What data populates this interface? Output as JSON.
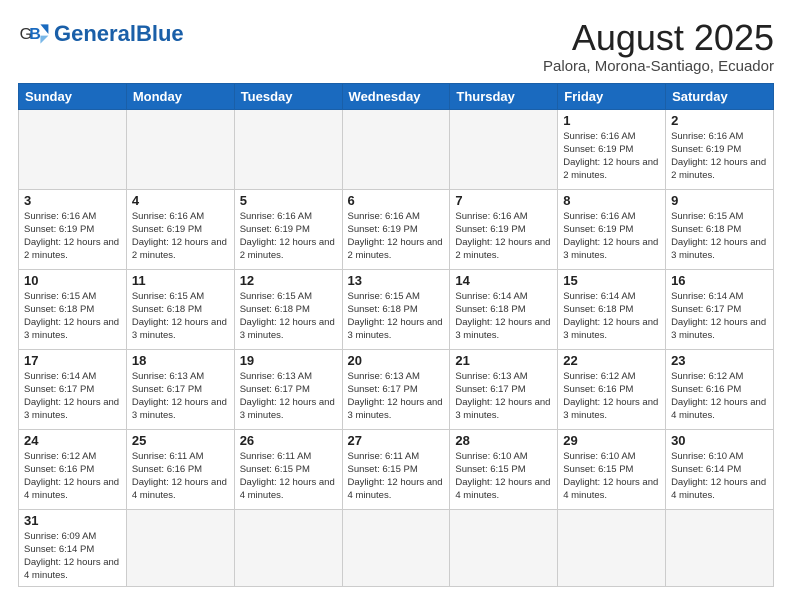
{
  "header": {
    "logo_text_normal": "General",
    "logo_text_bold": "Blue",
    "title": "August 2025",
    "subtitle": "Palora, Morona-Santiago, Ecuador"
  },
  "calendar": {
    "days_of_week": [
      "Sunday",
      "Monday",
      "Tuesday",
      "Wednesday",
      "Thursday",
      "Friday",
      "Saturday"
    ],
    "weeks": [
      [
        {
          "day": "",
          "info": ""
        },
        {
          "day": "",
          "info": ""
        },
        {
          "day": "",
          "info": ""
        },
        {
          "day": "",
          "info": ""
        },
        {
          "day": "",
          "info": ""
        },
        {
          "day": "1",
          "info": "Sunrise: 6:16 AM\nSunset: 6:19 PM\nDaylight: 12 hours and 2 minutes."
        },
        {
          "day": "2",
          "info": "Sunrise: 6:16 AM\nSunset: 6:19 PM\nDaylight: 12 hours and 2 minutes."
        }
      ],
      [
        {
          "day": "3",
          "info": "Sunrise: 6:16 AM\nSunset: 6:19 PM\nDaylight: 12 hours and 2 minutes."
        },
        {
          "day": "4",
          "info": "Sunrise: 6:16 AM\nSunset: 6:19 PM\nDaylight: 12 hours and 2 minutes."
        },
        {
          "day": "5",
          "info": "Sunrise: 6:16 AM\nSunset: 6:19 PM\nDaylight: 12 hours and 2 minutes."
        },
        {
          "day": "6",
          "info": "Sunrise: 6:16 AM\nSunset: 6:19 PM\nDaylight: 12 hours and 2 minutes."
        },
        {
          "day": "7",
          "info": "Sunrise: 6:16 AM\nSunset: 6:19 PM\nDaylight: 12 hours and 2 minutes."
        },
        {
          "day": "8",
          "info": "Sunrise: 6:16 AM\nSunset: 6:19 PM\nDaylight: 12 hours and 3 minutes."
        },
        {
          "day": "9",
          "info": "Sunrise: 6:15 AM\nSunset: 6:18 PM\nDaylight: 12 hours and 3 minutes."
        }
      ],
      [
        {
          "day": "10",
          "info": "Sunrise: 6:15 AM\nSunset: 6:18 PM\nDaylight: 12 hours and 3 minutes."
        },
        {
          "day": "11",
          "info": "Sunrise: 6:15 AM\nSunset: 6:18 PM\nDaylight: 12 hours and 3 minutes."
        },
        {
          "day": "12",
          "info": "Sunrise: 6:15 AM\nSunset: 6:18 PM\nDaylight: 12 hours and 3 minutes."
        },
        {
          "day": "13",
          "info": "Sunrise: 6:15 AM\nSunset: 6:18 PM\nDaylight: 12 hours and 3 minutes."
        },
        {
          "day": "14",
          "info": "Sunrise: 6:14 AM\nSunset: 6:18 PM\nDaylight: 12 hours and 3 minutes."
        },
        {
          "day": "15",
          "info": "Sunrise: 6:14 AM\nSunset: 6:18 PM\nDaylight: 12 hours and 3 minutes."
        },
        {
          "day": "16",
          "info": "Sunrise: 6:14 AM\nSunset: 6:17 PM\nDaylight: 12 hours and 3 minutes."
        }
      ],
      [
        {
          "day": "17",
          "info": "Sunrise: 6:14 AM\nSunset: 6:17 PM\nDaylight: 12 hours and 3 minutes."
        },
        {
          "day": "18",
          "info": "Sunrise: 6:13 AM\nSunset: 6:17 PM\nDaylight: 12 hours and 3 minutes."
        },
        {
          "day": "19",
          "info": "Sunrise: 6:13 AM\nSunset: 6:17 PM\nDaylight: 12 hours and 3 minutes."
        },
        {
          "day": "20",
          "info": "Sunrise: 6:13 AM\nSunset: 6:17 PM\nDaylight: 12 hours and 3 minutes."
        },
        {
          "day": "21",
          "info": "Sunrise: 6:13 AM\nSunset: 6:17 PM\nDaylight: 12 hours and 3 minutes."
        },
        {
          "day": "22",
          "info": "Sunrise: 6:12 AM\nSunset: 6:16 PM\nDaylight: 12 hours and 3 minutes."
        },
        {
          "day": "23",
          "info": "Sunrise: 6:12 AM\nSunset: 6:16 PM\nDaylight: 12 hours and 4 minutes."
        }
      ],
      [
        {
          "day": "24",
          "info": "Sunrise: 6:12 AM\nSunset: 6:16 PM\nDaylight: 12 hours and 4 minutes."
        },
        {
          "day": "25",
          "info": "Sunrise: 6:11 AM\nSunset: 6:16 PM\nDaylight: 12 hours and 4 minutes."
        },
        {
          "day": "26",
          "info": "Sunrise: 6:11 AM\nSunset: 6:15 PM\nDaylight: 12 hours and 4 minutes."
        },
        {
          "day": "27",
          "info": "Sunrise: 6:11 AM\nSunset: 6:15 PM\nDaylight: 12 hours and 4 minutes."
        },
        {
          "day": "28",
          "info": "Sunrise: 6:10 AM\nSunset: 6:15 PM\nDaylight: 12 hours and 4 minutes."
        },
        {
          "day": "29",
          "info": "Sunrise: 6:10 AM\nSunset: 6:15 PM\nDaylight: 12 hours and 4 minutes."
        },
        {
          "day": "30",
          "info": "Sunrise: 6:10 AM\nSunset: 6:14 PM\nDaylight: 12 hours and 4 minutes."
        }
      ],
      [
        {
          "day": "31",
          "info": "Sunrise: 6:09 AM\nSunset: 6:14 PM\nDaylight: 12 hours and 4 minutes."
        },
        {
          "day": "",
          "info": ""
        },
        {
          "day": "",
          "info": ""
        },
        {
          "day": "",
          "info": ""
        },
        {
          "day": "",
          "info": ""
        },
        {
          "day": "",
          "info": ""
        },
        {
          "day": "",
          "info": ""
        }
      ]
    ]
  }
}
